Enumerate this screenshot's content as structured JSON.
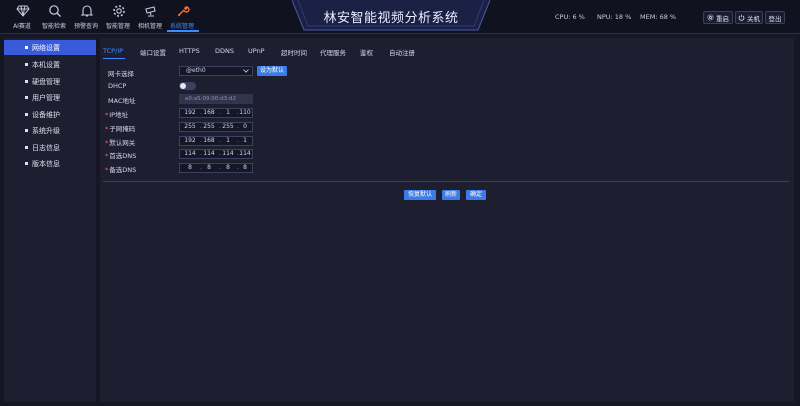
{
  "nav": [
    {
      "label": "AI赛道",
      "icon": "gem-icon"
    },
    {
      "label": "智能检索",
      "icon": "search-icon"
    },
    {
      "label": "预警查询",
      "icon": "alarm-bell-icon"
    },
    {
      "label": "智能管理",
      "icon": "gear-icon"
    },
    {
      "label": "相机管理",
      "icon": "camera-icon"
    },
    {
      "label": "系统管理",
      "icon": "wrench-icon",
      "active": true
    }
  ],
  "app_title": "林安智能视频分析系统",
  "stats": {
    "cpu": "CPU: 6 %",
    "npu": "NPU: 18 %",
    "mem": "MEM: 68 %"
  },
  "top_buttons": {
    "restart": "重启",
    "shutdown": "关机",
    "logout": "登出"
  },
  "sidebar": [
    {
      "label": "网络设置",
      "active": true
    },
    {
      "label": "本机设置"
    },
    {
      "label": "硬盘管理"
    },
    {
      "label": "用户管理"
    },
    {
      "label": "设备维护"
    },
    {
      "label": "系统升级"
    },
    {
      "label": "日志信息"
    },
    {
      "label": "版本信息"
    }
  ],
  "tabs": [
    "TCP/IP",
    "端口设置",
    "HTTPS",
    "DDNS",
    "UPnP",
    "超时时间",
    "代理服务",
    "鉴权",
    "自动注册"
  ],
  "form": {
    "nic_label": "网卡选择",
    "nic_value": "@eth0",
    "set_default": "设为默认",
    "dhcp_label": "DHCP",
    "dhcp_on": false,
    "mac_label": "MAC地址",
    "mac_value": "e0:a5:09:00:d3:d2",
    "ip_label": "IP地址",
    "ip": [
      "192",
      "168",
      "1",
      "110"
    ],
    "mask_label": "子网掩码",
    "mask": [
      "255",
      "255",
      "255",
      "0"
    ],
    "gateway_label": "默认网关",
    "gateway": [
      "192",
      "168",
      "1",
      "1"
    ],
    "dns1_label": "首选DNS",
    "dns1": [
      "114",
      "114",
      "114",
      "114"
    ],
    "dns2_label": "备选DNS",
    "dns2": [
      "8",
      "8",
      "8",
      "8"
    ]
  },
  "actions": {
    "restore": "恢复默认",
    "refresh": "刷新",
    "confirm": "确定"
  },
  "colors": {
    "accent": "#3d8cff",
    "sidebar_active": "#3a5bd9",
    "button": "#3d7be6",
    "required": "#ff5a5a"
  }
}
